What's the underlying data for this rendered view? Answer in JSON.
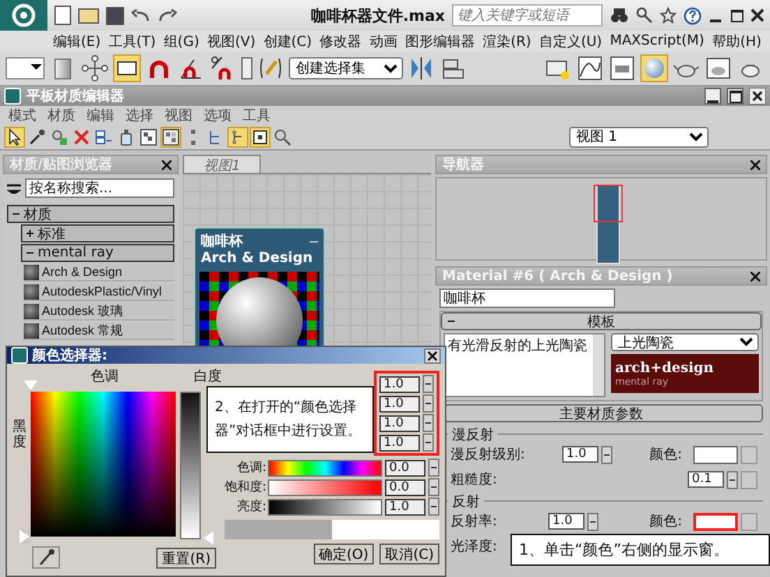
{
  "window": {
    "title": "咖啡杯器文件.max",
    "search_placeholder": "键入关键字或短语"
  },
  "menu": [
    "编辑(E)",
    "工具(T)",
    "组(G)",
    "视图(V)",
    "创建(C)",
    "修改器",
    "动画",
    "图形编辑器",
    "渲染(R)",
    "自定义(U)",
    "MAXScript(M)",
    "帮助(H)"
  ],
  "toolbar": {
    "selection_set": "创建选择集"
  },
  "editor": {
    "title": "平板材质编辑器",
    "menu": [
      "模式",
      "材质",
      "编辑",
      "选择",
      "视图",
      "选项",
      "工具"
    ],
    "view_select": "视图 1"
  },
  "browser": {
    "title": "材质/贴图浏览器",
    "search_placeholder": "按名称搜索...",
    "groups": [
      {
        "label": "材质",
        "expanded": true,
        "children": [
          {
            "label": "标准",
            "expanded": false
          },
          {
            "label": "mental ray",
            "expanded": true,
            "items": [
              "Arch & Design",
              "AutodeskPlastic/Vinyl",
              "Autodesk 玻璃",
              "Autodesk 常规"
            ]
          }
        ]
      }
    ]
  },
  "view": {
    "tab": "视图1",
    "node": {
      "title": "咖啡杯",
      "subtitle": "Arch & Design"
    }
  },
  "navigator": {
    "title": "导航器"
  },
  "material": {
    "title": "Material #6  ( Arch & Design )",
    "name": "咖啡杯",
    "template": {
      "title": "模板",
      "list_item": "有光滑反射的上光陶瓷",
      "preset": "上光陶瓷",
      "logo": "arch+design",
      "logo_sub": "mental ray"
    },
    "main": {
      "title": "主要材质参数",
      "groups": [
        {
          "title": "漫反射",
          "rows": [
            {
              "label": "漫反射级别:",
              "value": "1.0",
              "color_label": "颜色:",
              "highlighted": false
            },
            {
              "label": "粗糙度:",
              "value": "0.1"
            }
          ]
        },
        {
          "title": "反射",
          "rows": [
            {
              "label": "反射率:",
              "value": "1.0",
              "color_label": "颜色:",
              "highlighted": true
            },
            {
              "label": "光泽度:"
            }
          ]
        }
      ]
    }
  },
  "color_dialog": {
    "title": "颜色选择器:",
    "hue_label": "色调",
    "whiteness_label": "白度",
    "blackness_label": "黑度",
    "rgba_values": [
      "1.0",
      "1.0",
      "1.0",
      "1.0"
    ],
    "rgba_highlighted": true,
    "hsv": [
      {
        "label": "色调:",
        "value": "0.0"
      },
      {
        "label": "饱和度:",
        "value": "0.0"
      },
      {
        "label": "亮度:",
        "value": "1.0"
      }
    ],
    "reset": "重置(R)",
    "ok": "确定(O)",
    "cancel": "取消(C)"
  },
  "annotations": [
    "2、在打开的“颜色选择器”对话框中进行设置。",
    "1、单击“颜色”右侧的显示窗。"
  ]
}
